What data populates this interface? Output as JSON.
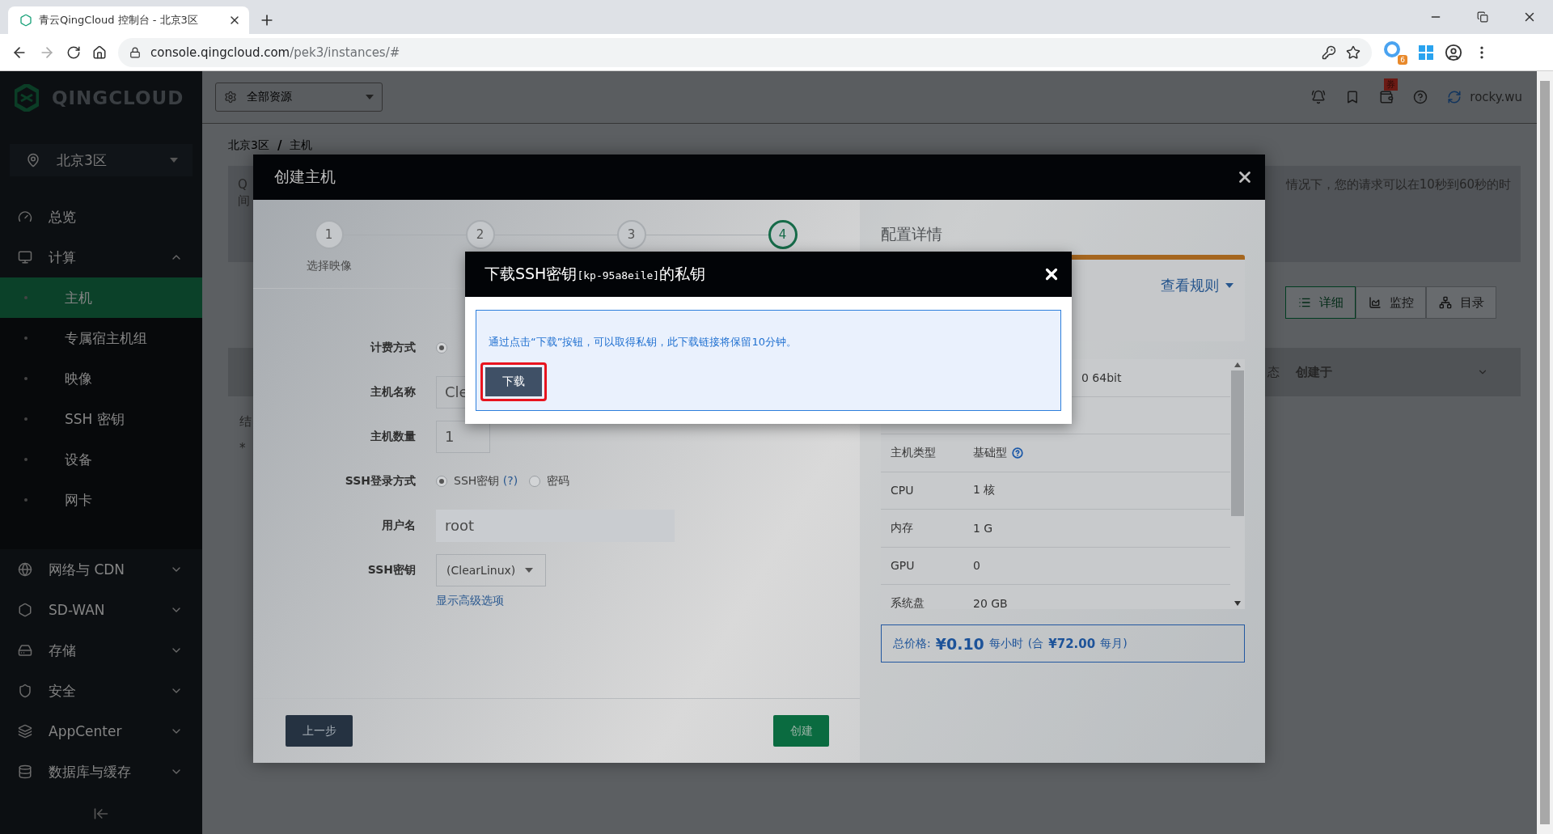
{
  "browser": {
    "tab_title": "青云QingCloud 控制台 - 北京3区",
    "url_host": "console.qingcloud.com",
    "url_path": "/pek3/instances/#",
    "extension_badge": "6"
  },
  "sidebar": {
    "brand": "QINGCLOUD",
    "zone": "北京3区",
    "items": [
      {
        "label": "总览"
      },
      {
        "label": "计算",
        "expanded": true,
        "children": [
          {
            "label": "主机",
            "selected": true
          },
          {
            "label": "专属宿主机组",
            "selected": false
          },
          {
            "label": "映像",
            "selected": false
          },
          {
            "label": "SSH 密钥",
            "selected": false
          },
          {
            "label": "设备",
            "selected": false
          },
          {
            "label": "网卡",
            "selected": false
          }
        ]
      },
      {
        "label": "网络与 CDN",
        "expanded": false
      },
      {
        "label": "SD-WAN",
        "expanded": false
      },
      {
        "label": "存储",
        "expanded": false
      },
      {
        "label": "安全",
        "expanded": false
      },
      {
        "label": "AppCenter",
        "expanded": false
      },
      {
        "label": "数据库与缓存",
        "expanded": false
      }
    ]
  },
  "header": {
    "resource_selector": "全部资源",
    "coupon_badge": "券",
    "user": "rocky.wu"
  },
  "breadcrumb": [
    "北京3区",
    "主机"
  ],
  "breadcrumb_separator": "/",
  "page": {
    "notice_fragments": [
      "Q",
      "间"
    ],
    "notice_tail": "情况下，您的请求可以在10秒到60秒的时",
    "view_tabs": [
      {
        "label": "详细",
        "selected": true
      },
      {
        "label": "监控",
        "selected": false
      },
      {
        "label": "目录",
        "selected": false
      }
    ],
    "table_columns": [
      "态",
      "创建于"
    ],
    "left_fragments": [
      "结",
      "*"
    ]
  },
  "dialog": {
    "title": "创建主机",
    "steps": [
      {
        "number": "1",
        "label": "选择映像",
        "current": false
      },
      {
        "number": "2",
        "current": false
      },
      {
        "number": "3",
        "current": false
      },
      {
        "number": "4",
        "current": true
      }
    ],
    "form": [
      {
        "label": "计费方式",
        "kind": "radio",
        "options": [
          {
            "selected": true
          }
        ]
      },
      {
        "label": "主机名称",
        "kind": "input",
        "value": "Cle"
      },
      {
        "label": "主机数量",
        "kind": "input",
        "value": "1"
      },
      {
        "label": "SSH登录方式",
        "kind": "radio",
        "options": [
          {
            "label": "SSH密钥",
            "help": "(?)",
            "selected": true
          },
          {
            "label": "密码",
            "selected": false
          }
        ]
      },
      {
        "label": "用户名",
        "kind": "input",
        "value": "root",
        "disabled": true
      },
      {
        "label": "SSH密钥",
        "kind": "select",
        "value": "(ClearLinux)"
      }
    ],
    "advanced_link": "显示高级选项",
    "back_button": "上一步",
    "create_button": "创建",
    "summary": {
      "title": "配置详情",
      "rules_link": "查看规则",
      "rows": [
        {
          "kind": "clipped",
          "value": "0 64bit"
        },
        {
          "kind": "covered"
        },
        {
          "kind": "plain",
          "label": "主机类型",
          "value": "基础型",
          "help": true
        },
        {
          "kind": "plain",
          "label": "CPU",
          "value": "1 核"
        },
        {
          "kind": "plain",
          "label": "内存",
          "value": "1 G"
        },
        {
          "kind": "plain",
          "label": "GPU",
          "value": "0"
        },
        {
          "kind": "plain",
          "label": "系统盘",
          "value": "20 GB"
        }
      ],
      "price": {
        "label": "总价格:",
        "hourly": "¥0.10",
        "hourly_unit": "每小时",
        "monthly_prefix": "(合",
        "monthly": "¥72.00",
        "monthly_unit": "每月)"
      }
    }
  },
  "modal": {
    "title": "下载SSH密钥",
    "key_name": "[kp-95a8eile]",
    "title_suffix": "的私钥",
    "message": "通过点击“下载”按钮，可以取得私钥，此下载链接将保留10分钟。",
    "download_button": "下载"
  }
}
